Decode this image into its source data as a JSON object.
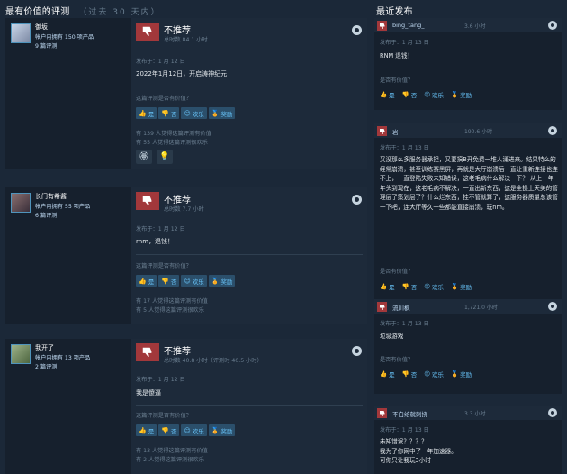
{
  "left_header": {
    "title": "最有价值的评测",
    "subtitle": "（过去 30 天内）"
  },
  "right_header": {
    "title": "最近发布"
  },
  "colors": {
    "not_recommended": "#a2383b",
    "bg": "#1b2838",
    "accent": "#67c1f5"
  },
  "buttons": {
    "yes": "是",
    "no": "否",
    "funny": "欢乐",
    "award": "奖励"
  },
  "helpful_question": "这篇评测是否有价值？",
  "reviews": [
    {
      "author": "御坂",
      "products": "帐户内拥有 150 项产品",
      "reviews_count": "9 篇评测",
      "verdict": "不推荐",
      "hours": "总时数 84.1 小时",
      "posted": "发布于：1 月 12 日",
      "text": "2022年1月12日，开启涛神纪元",
      "stat1": "有 139 人觉得这篇评测有价值",
      "stat2": "有 55 人觉得这篇评测很欢乐",
      "awards": [
        "award-icon",
        "award-icon"
      ]
    },
    {
      "author": "长门有希酱",
      "products": "帐户内拥有 55 项产品",
      "reviews_count": "6 篇评测",
      "verdict": "不推荐",
      "hours": "总时数 7.7 小时",
      "posted": "发布于：1 月 12 日",
      "text": "rnm，退钱！",
      "stat1": "有 17 人觉得这篇评测有价值",
      "stat2": "有 5 人觉得这篇评测很欢乐"
    },
    {
      "author": "我开了",
      "products": "帐户内拥有 13 项产品",
      "reviews_count": "2 篇评测",
      "verdict": "不推荐",
      "hours": "总时数 40.8 小时（评测时 40.5 小时）",
      "posted": "发布于：1 月 12 日",
      "text": "我是傻逼",
      "stat1": "有 13 人觉得这篇评测有价值",
      "stat2": "有 2 人觉得这篇评测很欢乐"
    }
  ],
  "recent": [
    {
      "name": "bing_tang_",
      "hours": "3.6 小时",
      "posted": "发布于：1 月 13 日",
      "text": "RNM 退钱！",
      "question": "是否有价值？"
    },
    {
      "name": "岩",
      "hours": "190.6 小时",
      "posted": "发布于：1 月 13 日",
      "text": "又没那么多服务器承担，又要搞B开免费一堆人涌进来。结果特么的经常崩溃，甚至训练赛黑屏，再就是大厅崩溃后一直让重新连接也连不上，一直登陆失败未知错误，这老毛病什么解决一下？ 从上一年年头到现在，这老毛病不解决，一直出新东西，这是全换上天美的管理层了策划层了？什么烂东西，挂不管就算了，这服务器质量总该管一下吧，连大厅等久一些都能直接崩溃，玩nm。",
      "question": "是否有价值？"
    },
    {
      "name": "流川枫",
      "hours": "1,721.0 小时",
      "posted": "发布于：1 月 13 日",
      "text": "垃圾游戏",
      "question": "是否有价值？"
    },
    {
      "name": "不白给就刺挠",
      "hours": "3.3 小时",
      "posted": "发布于：1 月 13 日",
      "text": "未知错误？？？？\n我为了你网中了一年加速器。\n可你只让我玩3小时",
      "question": ""
    }
  ]
}
